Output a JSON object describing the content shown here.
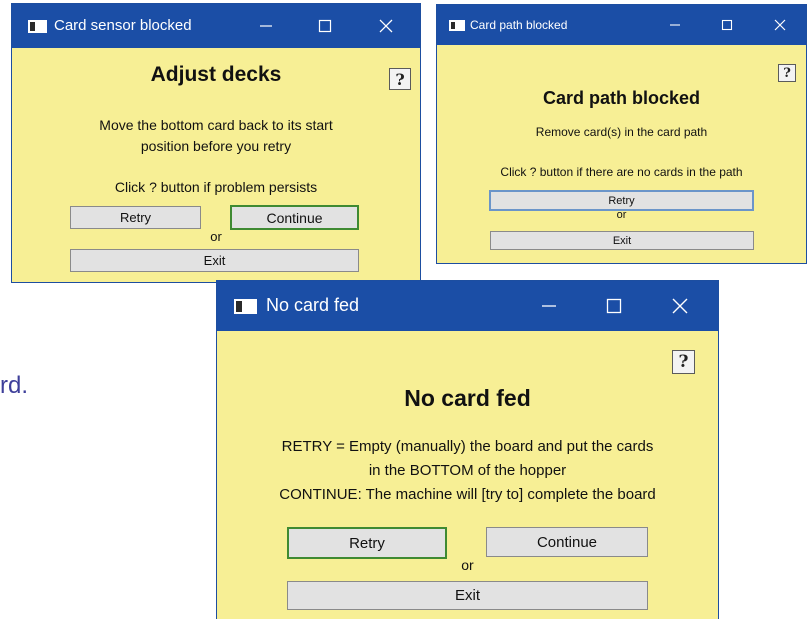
{
  "background": {
    "partial_text": "rd."
  },
  "colors": {
    "titlebar": "#1b4ea6",
    "dialog_bg": "#f7ef95",
    "focus_border": "#3f8a32"
  },
  "win1": {
    "title": "Card sensor blocked",
    "heading": "Adjust decks",
    "message_lines": [
      "Move the bottom card back to its start",
      "position before you retry"
    ],
    "hint": "Click ? button if problem persists",
    "help_label": "?",
    "retry": "Retry",
    "continue": "Continue",
    "or": "or",
    "exit": "Exit"
  },
  "win2": {
    "title": "Card path blocked",
    "heading": "Card path blocked",
    "message": "Remove card(s) in the card path",
    "hint": "Click ? button if there are no cards in the path",
    "help_label": "?",
    "retry": "Retry",
    "or": "or",
    "exit": "Exit"
  },
  "win3": {
    "title": "No card fed",
    "heading": "No card fed",
    "message_lines": [
      "RETRY = Empty (manually) the board and put the cards",
      "in the BOTTOM of the hopper",
      "CONTINUE: The machine will [try to] complete the board"
    ],
    "help_label": "?",
    "retry": "Retry",
    "continue": "Continue",
    "or": "or",
    "exit": "Exit"
  }
}
